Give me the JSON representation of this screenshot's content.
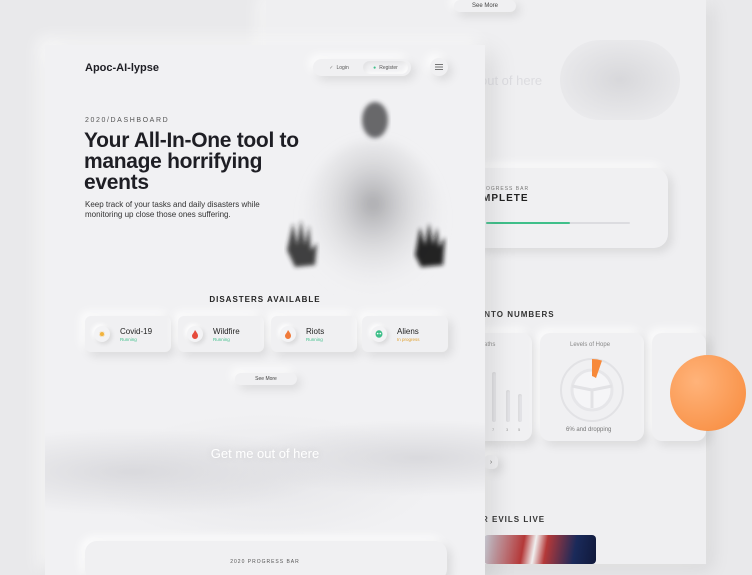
{
  "app": {
    "logo": "Apoc-AI-lypse"
  },
  "header": {
    "login_label": "Login",
    "register_label": "Register"
  },
  "hero": {
    "kicker": "2020/DASHBOARD",
    "title": "Your All-In-One tool to manage horrifying events",
    "description": "Keep track of your tasks and daily disasters while monitoring up close those ones suffering."
  },
  "disasters": {
    "title": "DISASTERS AVAILABLE",
    "items": [
      {
        "name": "Covid-19",
        "status": "Running",
        "icon": "virus-icon",
        "color": "#f2b33d"
      },
      {
        "name": "Wildfire",
        "status": "Running",
        "icon": "fire-icon",
        "color": "#e64b3c"
      },
      {
        "name": "Riots",
        "status": "Running",
        "icon": "flame-icon",
        "color": "#f07a3a"
      },
      {
        "name": "Aliens",
        "status": "In progress",
        "icon": "alien-icon",
        "color": "#3fbf8a"
      }
    ],
    "see_more": "See More"
  },
  "cta": {
    "text": "Get me out of here"
  },
  "progress_section": {
    "kicker": "2020 PROGRESS BAR"
  },
  "background_panel": {
    "see_more": "See More",
    "get_out_partial": "out of here",
    "progress_kicker_partial": "OGRESS BAR",
    "progress_title_partial": "MPLETE",
    "progress_fraction": 0.58,
    "numbers_title_partial": "INTO NUMBERS",
    "deaths_label_partial": "aths",
    "ticks": [
      "7",
      "3",
      "5"
    ],
    "hope_label": "Levels of Hope",
    "hope_value": "6% and dropping",
    "evils_title_partial": "R EVILS LIVE"
  },
  "colors": {
    "accent_green": "#3fbf8a",
    "accent_orange": "#f7893a",
    "background": "#f1f1f3"
  }
}
